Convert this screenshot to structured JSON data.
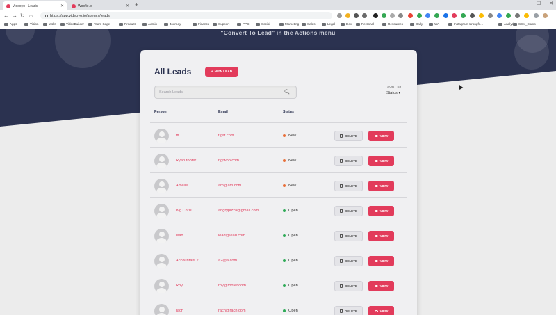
{
  "browser": {
    "tabs": [
      {
        "title": "Videoyo - Leads",
        "active": true
      },
      {
        "title": "Woofie.io",
        "active": false
      }
    ],
    "url": "https://app.videoyo.io/agency/leads",
    "bookmarks": [
      "Apps",
      "Vision",
      "tasks",
      "VideoBuilder",
      "Team Sage",
      "Product",
      "Admin",
      "Journey",
      "Finance",
      "Support",
      "PPC",
      "Social",
      "Marketing",
      "Sales",
      "Legal",
      "Dev",
      "Personal",
      "Resources",
      "Daily",
      "WA",
      "Instagram strongfo...",
      "Analytics",
      "SEM_Camo"
    ]
  },
  "hero": {
    "hint": "\"Convert To Lead\" in the Actions menu"
  },
  "card": {
    "title": "All Leads",
    "new_lead_label": "NEW LEAD",
    "search_placeholder": "Search Leads",
    "sort_label": "SORT BY",
    "sort_value": "Status",
    "columns": {
      "person": "Person",
      "email": "Email",
      "status": "Status"
    },
    "delete_label": "DELETE",
    "view_label": "VIEW"
  },
  "leads": [
    {
      "name": "ttt",
      "email": "t@tt.com",
      "status": "New"
    },
    {
      "name": "Ryan roofer",
      "email": "r@woo.com",
      "status": "New"
    },
    {
      "name": "Amelie",
      "email": "am@am.com",
      "status": "New"
    },
    {
      "name": "Big Chris",
      "email": "angrypizza@gmail.com",
      "status": "Open"
    },
    {
      "name": "lead",
      "email": "lead@lead.com",
      "status": "Open"
    },
    {
      "name": "Accountant 2",
      "email": "a2@a.com",
      "status": "Open"
    },
    {
      "name": "Roy",
      "email": "roy@roofer.com",
      "status": "Open"
    },
    {
      "name": "rach",
      "email": "rach@rach.com",
      "status": "Open"
    }
  ],
  "colors": {
    "accent": "#e23b5b",
    "navy": "#2b3250",
    "status_new": "#e8703a",
    "status_open": "#2eaa57"
  }
}
